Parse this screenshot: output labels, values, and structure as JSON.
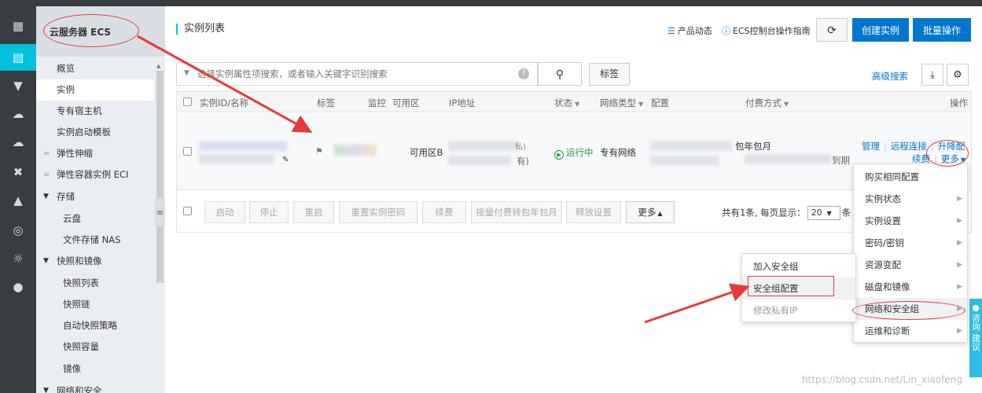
{
  "sidebar": {
    "title": "云服务器 ECS",
    "items": [
      {
        "label": "概览"
      },
      {
        "label": "实例"
      },
      {
        "label": "专有宿主机"
      },
      {
        "label": "实例启动模板"
      },
      {
        "label": "弹性伸缩"
      },
      {
        "label": "弹性容器实例 ECI"
      },
      {
        "label": "存储"
      },
      {
        "label": "云盘"
      },
      {
        "label": "文件存储 NAS"
      },
      {
        "label": "快照和镜像"
      },
      {
        "label": "快照列表"
      },
      {
        "label": "快照链"
      },
      {
        "label": "自动快照策略"
      },
      {
        "label": "快照容量"
      },
      {
        "label": "镜像"
      },
      {
        "label": "网络和安全"
      }
    ]
  },
  "header": {
    "title": "实例列表",
    "product_news": "产品动态",
    "guide": "ECS控制台操作指南",
    "refresh_icon": "refresh-icon",
    "create_label": "创建实例",
    "batch_label": "批量操作"
  },
  "search": {
    "placeholder": "选择实例属性项搜索，或者输入关键字识别搜索",
    "help": "?",
    "tag_label": "标签",
    "advanced_label": "高级搜索"
  },
  "table": {
    "columns": {
      "id": "实例ID/名称",
      "tag": "标签",
      "monitor": "监控",
      "zone": "可用区",
      "ip": "IP地址",
      "status": "状态",
      "net": "网络类型",
      "config": "配置",
      "pay": "付费方式",
      "ops": "操作"
    },
    "row": {
      "zone": "可用区B",
      "ip_suffix_a": "私)",
      "ip_suffix_b": "有)",
      "status": "运行中",
      "net": "专有网络",
      "pay": "包年包月",
      "pay_suffix": "到期",
      "ops": {
        "manage": "管理",
        "remote": "远程连接",
        "upgrade": "升降配",
        "renew": "续费",
        "more": "更多"
      }
    },
    "footer": {
      "buttons": [
        "启动",
        "停止",
        "重启",
        "重置实例密码",
        "续费",
        "按量付费转包年包月",
        "释放设置",
        "更多"
      ],
      "pager_prefix": "共有1条, 每页显示：",
      "page_size": "20",
      "pager_suffix": "条"
    }
  },
  "more_menu": [
    {
      "label": "购买相同配置",
      "sub": false
    },
    {
      "label": "实例状态",
      "sub": true
    },
    {
      "label": "实例设置",
      "sub": true
    },
    {
      "label": "密码/密钥",
      "sub": true
    },
    {
      "label": "资源变配",
      "sub": true
    },
    {
      "label": "磁盘和镜像",
      "sub": true
    },
    {
      "label": "网络和安全组",
      "sub": true
    },
    {
      "label": "运维和诊断",
      "sub": true
    }
  ],
  "sub_menu": [
    {
      "label": "加入安全组"
    },
    {
      "label": "安全组配置"
    },
    {
      "label": "修改私有IP"
    }
  ],
  "side_tab": "咨询·建议",
  "watermark": "https://blog.csdn.net/Lin_xiaofeng",
  "colors": {
    "primary": "#0077cc",
    "rail": "#373d41",
    "accent": "#00c1de",
    "running": "#1e9e3a",
    "annotation": "#e43b3b"
  }
}
